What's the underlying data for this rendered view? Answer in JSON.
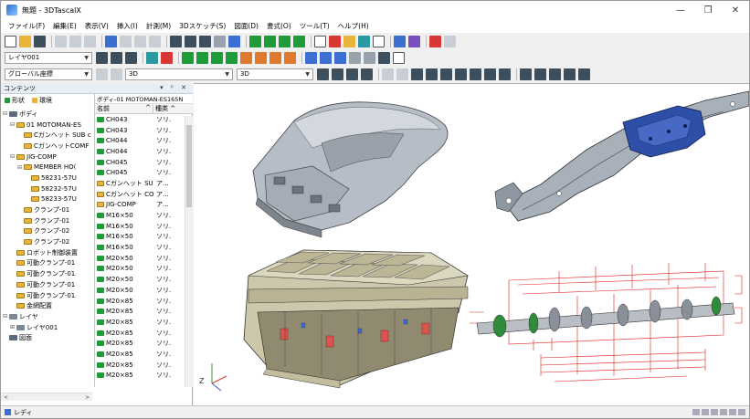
{
  "window": {
    "title": "無題 - 3DTascalX",
    "controls": [
      "—",
      "❐",
      "✕"
    ]
  },
  "menu": [
    "ファイル(F)",
    "編集(E)",
    "表示(V)",
    "挿入(I)",
    "計測(M)",
    "3Dスケッチ(S)",
    "図面(D)",
    "書式(O)",
    "ツール(T)",
    "ヘルプ(H)"
  ],
  "toolbar2": {
    "layer_value": "レイヤ001"
  },
  "toolbar3": {
    "coord_value": "グローバル座標",
    "view_value": "3D",
    "mode_value": "3D"
  },
  "panel": {
    "title": "コンテンツ",
    "pin": "▾ ᵖ ✕",
    "tabs": [
      {
        "label": "形状",
        "color": "#1e9c3a"
      },
      {
        "label": "環境",
        "color": "#e8b43a"
      }
    ],
    "tree": [
      {
        "indent": 0,
        "exp": "⊟",
        "icon": "drawing",
        "label": "ボディ"
      },
      {
        "indent": 1,
        "exp": "⊟",
        "icon": "part",
        "label": "01 MOTOMAN-ES"
      },
      {
        "indent": 2,
        "exp": "",
        "icon": "part",
        "label": "Cガンヘット SUB c"
      },
      {
        "indent": 2,
        "exp": "",
        "icon": "part",
        "label": "CガンヘットCOMF"
      },
      {
        "indent": 1,
        "exp": "⊟",
        "icon": "part",
        "label": "JIG-COMP"
      },
      {
        "indent": 2,
        "exp": "⊟",
        "icon": "part",
        "label": "MEMBER HO("
      },
      {
        "indent": 3,
        "exp": "",
        "icon": "part",
        "label": "58231-57U"
      },
      {
        "indent": 3,
        "exp": "",
        "icon": "part",
        "label": "58232-57U"
      },
      {
        "indent": 3,
        "exp": "",
        "icon": "part",
        "label": "58233-57U"
      },
      {
        "indent": 2,
        "exp": "",
        "icon": "part",
        "label": "クランプ-01"
      },
      {
        "indent": 2,
        "exp": "",
        "icon": "part",
        "label": "クランプ-01"
      },
      {
        "indent": 2,
        "exp": "",
        "icon": "part",
        "label": "クランプ-02"
      },
      {
        "indent": 2,
        "exp": "",
        "icon": "part",
        "label": "クランプ-02"
      },
      {
        "indent": 1,
        "exp": "",
        "icon": "part",
        "label": "ロボット制御装置"
      },
      {
        "indent": 1,
        "exp": "",
        "icon": "part",
        "label": "可動クランプ-01"
      },
      {
        "indent": 1,
        "exp": "",
        "icon": "part",
        "label": "可動クランプ-01"
      },
      {
        "indent": 1,
        "exp": "",
        "icon": "part",
        "label": "可動クランプ-01"
      },
      {
        "indent": 1,
        "exp": "",
        "icon": "part",
        "label": "可動クランプ-01"
      },
      {
        "indent": 1,
        "exp": "",
        "icon": "part",
        "label": "金網配置"
      },
      {
        "indent": 0,
        "exp": "⊟",
        "icon": "layer",
        "label": "レイヤ"
      },
      {
        "indent": 1,
        "exp": "⊞",
        "icon": "layer",
        "label": "レイヤ001"
      },
      {
        "indent": 0,
        "exp": "",
        "icon": "drawing",
        "label": "図面"
      }
    ],
    "list_title": "ボディ-01 MOTOMAN-ES165N",
    "list_headers": {
      "name": "名前",
      "type": "種类"
    },
    "list": [
      {
        "icon": "green",
        "name": "CH043",
        "type": "ソリ."
      },
      {
        "icon": "green",
        "name": "CH043",
        "type": "ソリ."
      },
      {
        "icon": "green",
        "name": "CH044",
        "type": "ソリ."
      },
      {
        "icon": "green",
        "name": "CH044",
        "type": "ソリ."
      },
      {
        "icon": "green",
        "name": "CH045",
        "type": "ソリ."
      },
      {
        "icon": "green",
        "name": "CH045",
        "type": "ソリ."
      },
      {
        "icon": "part",
        "name": "Cガンヘット SUB ...",
        "type": "ア..."
      },
      {
        "icon": "part",
        "name": "Cガンヘット COM...",
        "type": "ア..."
      },
      {
        "icon": "part",
        "name": "JIG-COMP",
        "type": "ア..."
      },
      {
        "icon": "green",
        "name": "M16×50",
        "type": "ソリ."
      },
      {
        "icon": "green",
        "name": "M16×50",
        "type": "ソリ."
      },
      {
        "icon": "green",
        "name": "M16×50",
        "type": "ソリ."
      },
      {
        "icon": "green",
        "name": "M16×50",
        "type": "ソリ."
      },
      {
        "icon": "green",
        "name": "M20×50",
        "type": "ソリ."
      },
      {
        "icon": "green",
        "name": "M20×50",
        "type": "ソリ."
      },
      {
        "icon": "green",
        "name": "M20×50",
        "type": "ソリ."
      },
      {
        "icon": "green",
        "name": "M20×50",
        "type": "ソリ."
      },
      {
        "icon": "green",
        "name": "M20×85",
        "type": "ソリ."
      },
      {
        "icon": "green",
        "name": "M20×85",
        "type": "ソリ."
      },
      {
        "icon": "green",
        "name": "M20×85",
        "type": "ソリ."
      },
      {
        "icon": "green",
        "name": "M20×85",
        "type": "ソリ."
      },
      {
        "icon": "green",
        "name": "M20×85",
        "type": "ソリ."
      },
      {
        "icon": "green",
        "name": "M20×85",
        "type": "ソリ."
      },
      {
        "icon": "green",
        "name": "M20×85",
        "type": "ソリ."
      },
      {
        "icon": "green",
        "name": "M20×85",
        "type": "ソリ."
      }
    ],
    "scroll_left": "<",
    "scroll_right": ">"
  },
  "viewport": {
    "axis_label": "Z"
  },
  "status": {
    "text": "レディ"
  },
  "colors": {
    "accent": "#3b6fd1",
    "jig": "#c8c3a4",
    "drawing": "#e02020"
  }
}
